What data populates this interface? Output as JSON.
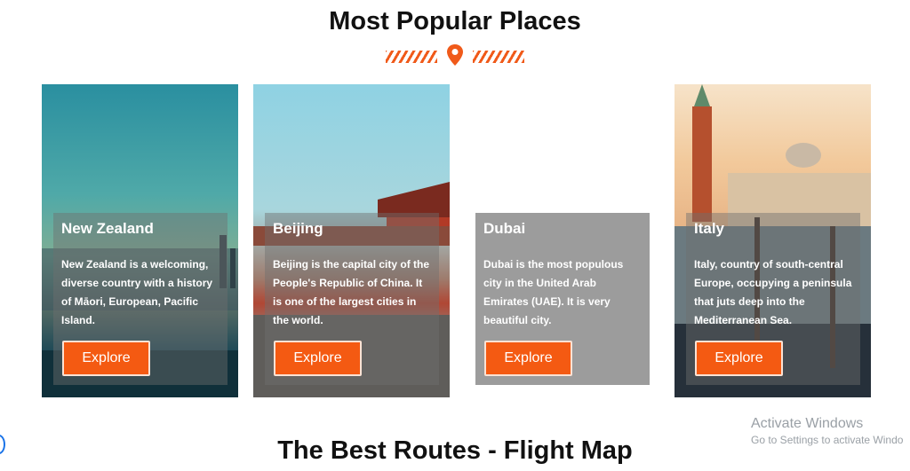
{
  "section_top": {
    "title": "Most Popular Places"
  },
  "divider": {
    "icon": "location-pin-icon",
    "accent_color": "#f05a1a"
  },
  "cards": [
    {
      "title": "New Zealand",
      "description": "New Zealand is a welcoming, diverse country with a history of Māori, European, Pacific Island.",
      "button_label": "Explore"
    },
    {
      "title": "Beijing",
      "description": "Beijing is the capital city of the People's Republic of China. It is one of the largest cities in the world.",
      "button_label": "Explore"
    },
    {
      "title": "Dubai",
      "description": "Dubai is the most populous city in the United Arab Emirates (UAE). It is very beautiful city.",
      "button_label": "Explore"
    },
    {
      "title": "Italy",
      "description": "Italy, country of south-central Europe, occupying a peninsula that juts deep into the Mediterranean Sea.",
      "button_label": "Explore"
    }
  ],
  "section_bottom": {
    "title": "The Best Routes - Flight Map"
  },
  "watermark": {
    "line1": "Activate Windows",
    "line2": "Go to Settings to activate Windo"
  }
}
